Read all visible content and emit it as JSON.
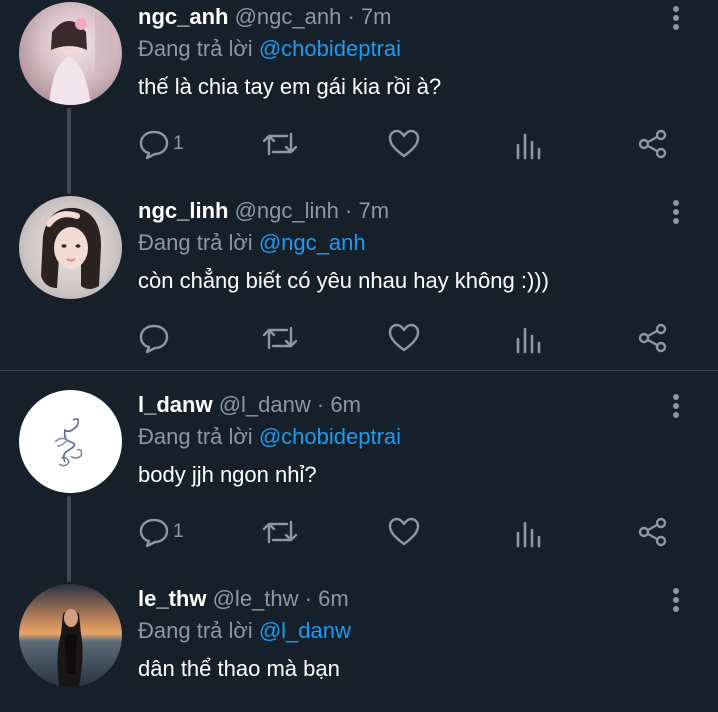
{
  "colors": {
    "background": "#15202b",
    "muted": "#8b98a5",
    "mention": "#1d9bf0",
    "thread_line": "#3d4a56"
  },
  "tweets": [
    {
      "name": "ngc_anh",
      "handle": "@ngc_anh",
      "separator": "·",
      "time": "7m",
      "reply_prefix": "Đang trả lời",
      "reply_to": "@chobideptrai",
      "text": "thế là chia tay em gái kia rồi à?",
      "reply_count": "1",
      "avatar_icon": "avatar-photo-icon"
    },
    {
      "name": "ngc_linh",
      "handle": "@ngc_linh",
      "separator": "·",
      "time": "7m",
      "reply_prefix": "Đang trả lời",
      "reply_to": "@ngc_anh",
      "text": "còn chẳng biết có yêu nhau hay không :)))",
      "reply_count": "",
      "avatar_icon": "avatar-photo-icon"
    },
    {
      "name": "l_danw",
      "handle": "@l_danw",
      "separator": "·",
      "time": "6m",
      "reply_prefix": "Đang trả lời",
      "reply_to": "@chobideptrai",
      "text": "body jjh ngon nhỉ?",
      "reply_count": "1",
      "avatar_icon": "avatar-sketch-icon"
    },
    {
      "name": "le_thw",
      "handle": "@le_thw",
      "separator": "·",
      "time": "6m",
      "reply_prefix": "Đang trả lời",
      "reply_to": "@l_danw",
      "text": "dân thể thao mà bạn",
      "avatar_icon": "avatar-photo-icon"
    }
  ]
}
